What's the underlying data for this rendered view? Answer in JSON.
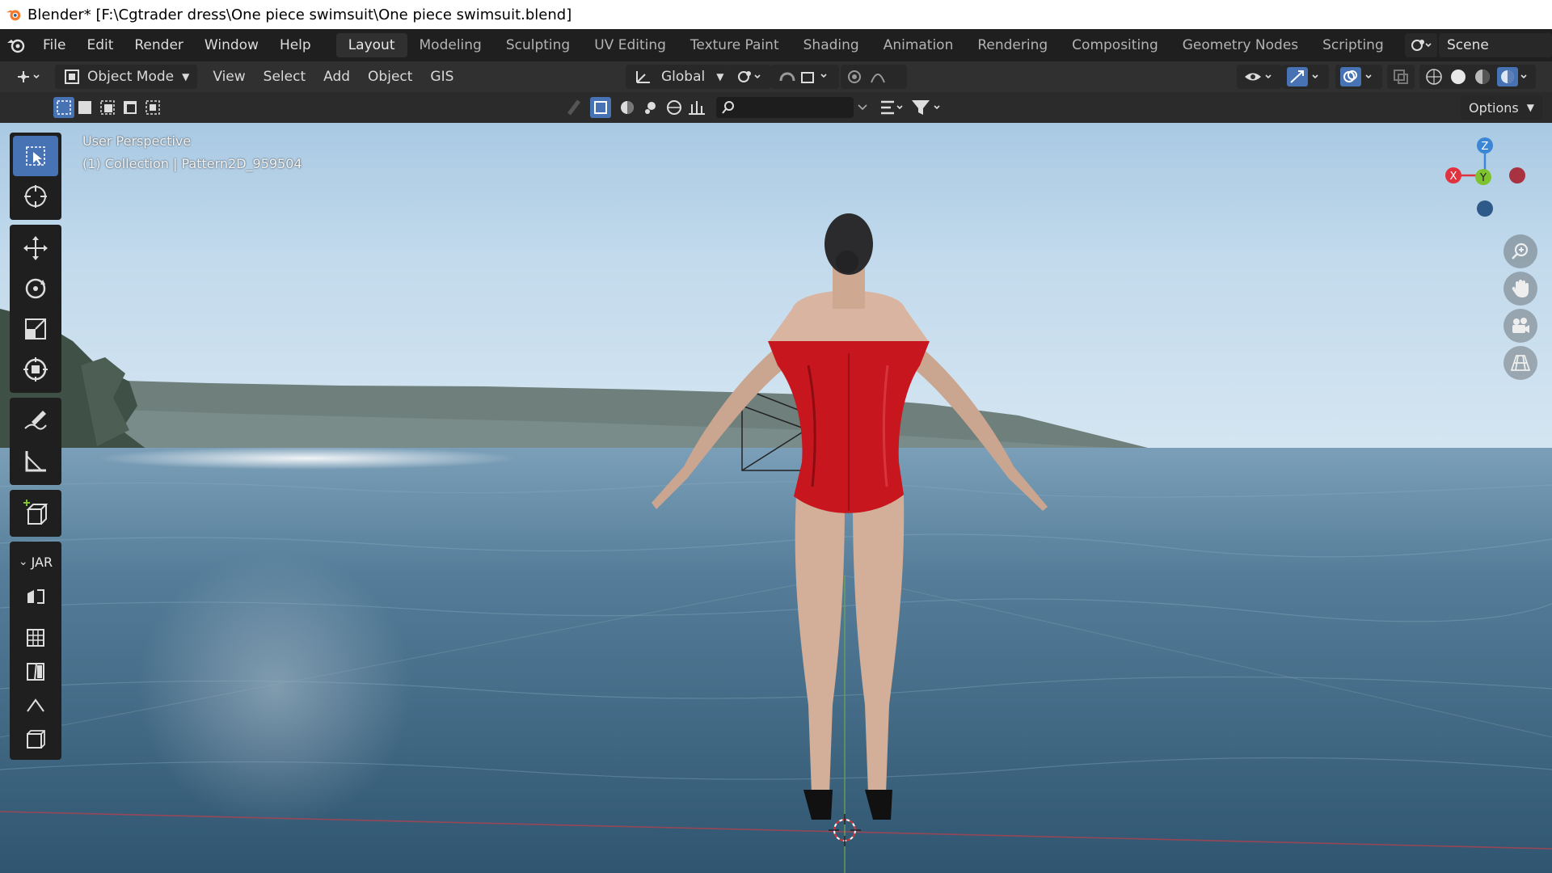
{
  "window": {
    "title": "Blender* [F:\\Cgtrader dress\\One piece swimsuit\\One piece swimsuit.blend]"
  },
  "menu": [
    "File",
    "Edit",
    "Render",
    "Window",
    "Help"
  ],
  "workspaces": [
    "Layout",
    "Modeling",
    "Sculpting",
    "UV Editing",
    "Texture Paint",
    "Shading",
    "Animation",
    "Rendering",
    "Compositing",
    "Geometry Nodes",
    "Scripting"
  ],
  "active_workspace": "Layout",
  "scene": {
    "name": "Scene"
  },
  "header": {
    "mode": "Object Mode",
    "menus": [
      "View",
      "Select",
      "Add",
      "Object",
      "GIS"
    ],
    "orientation": "Global"
  },
  "subheader": {
    "options_label": "Options"
  },
  "viewport": {
    "perspective": "User Perspective",
    "collection_info": "(1) Collection | Pattern2D_959504"
  },
  "gizmo": {
    "z": "Z",
    "x": "X",
    "y": "Y"
  },
  "toolbar": {
    "section_label": "JAR"
  },
  "colors": {
    "accent": "#4772b3",
    "swimsuit": "#c8161e",
    "x_axis": "#e0333f",
    "y_axis": "#7fc230",
    "z_axis": "#3b87d6"
  }
}
